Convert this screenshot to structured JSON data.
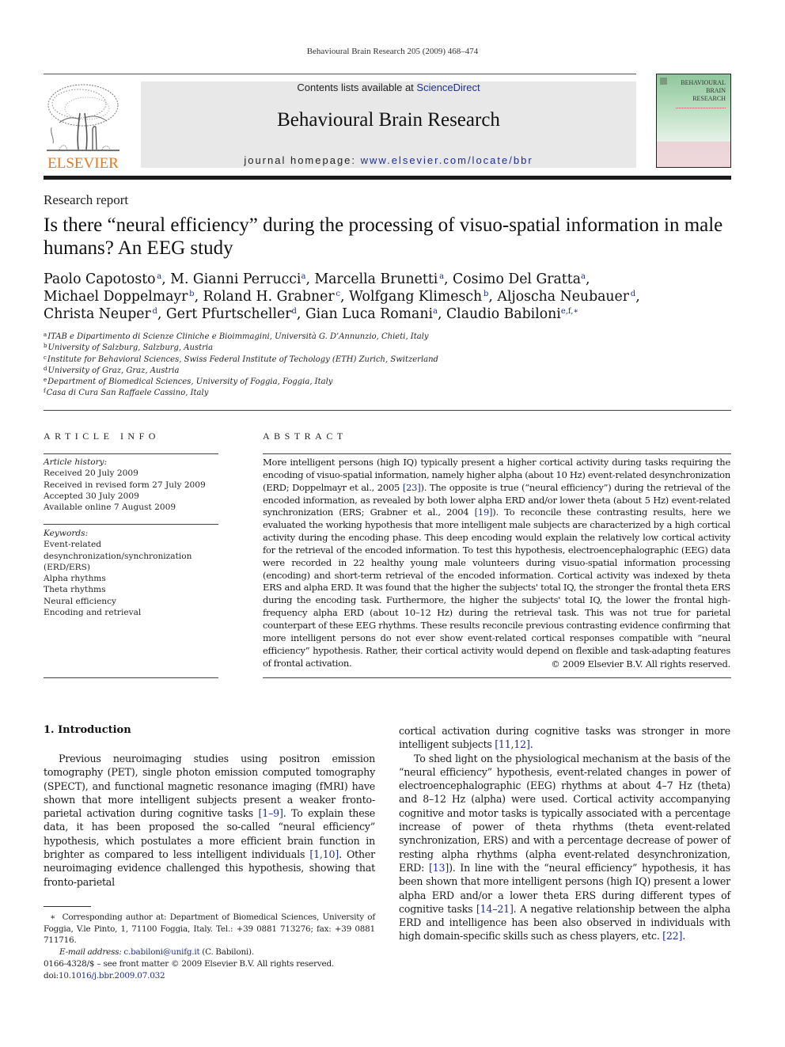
{
  "running_head": "Behavioural Brain Research 205 (2009) 468–474",
  "publisher": {
    "logo_icon": "elsevier-tree-icon",
    "name": "ELSEVIER",
    "brand_color": "#e87722"
  },
  "banner": {
    "contents_prefix": "Contents lists available at ",
    "contents_link": "ScienceDirect",
    "journal_title": "Behavioural Brain Research",
    "homepage_prefix": "journal homepage: ",
    "homepage_link": "www.elsevier.com/locate/bbr",
    "link_color": "#1f2f8f"
  },
  "cover": {
    "title_lines": [
      "BEHAVIOURAL",
      "BRAIN",
      "RESEARCH"
    ]
  },
  "article": {
    "type": "Research report",
    "title": "Is there “neural efficiency” during the processing of visuo-spatial information in male humans? An EEG study",
    "authors": [
      {
        "name": "Paolo Capotosto",
        "sup": "a"
      },
      {
        "name": "M. Gianni Perrucci",
        "sup": "a"
      },
      {
        "name": "Marcella Brunetti",
        "sup": "a"
      },
      {
        "name": "Cosimo Del Gratta",
        "sup": "a"
      },
      {
        "name": "Michael Doppelmayr",
        "sup": "b"
      },
      {
        "name": "Roland H. Grabner",
        "sup": "c"
      },
      {
        "name": "Wolfgang Klimesch",
        "sup": "b"
      },
      {
        "name": "Aljoscha Neubauer",
        "sup": "d"
      },
      {
        "name": "Christa Neuper",
        "sup": "d"
      },
      {
        "name": "Gert Pfurtscheller",
        "sup": "d"
      },
      {
        "name": "Gian Luca Romani",
        "sup": "a"
      },
      {
        "name": "Claudio Babiloni",
        "sup": "e,f,∗"
      }
    ],
    "affiliations": [
      {
        "key": "a",
        "text": "ITAB e Dipartimento di Scienze Cliniche e Bioimmagini, Università G. D’Annunzio, Chieti, Italy"
      },
      {
        "key": "b",
        "text": "University of Salzburg, Salzburg, Austria"
      },
      {
        "key": "c",
        "text": "Institute for Behavioral Sciences, Swiss Federal Institute of Techology (ETH) Zurich, Switzerland"
      },
      {
        "key": "d",
        "text": "University of Graz, Graz, Austria"
      },
      {
        "key": "e",
        "text": "Department of Biomedical Sciences, University of Foggia, Foggia, Italy"
      },
      {
        "key": "f",
        "text": "Casa di Cura San Raffaele Cassino, Italy"
      }
    ]
  },
  "article_info": {
    "heading": "ARTICLE INFO",
    "history_label": "Article history:",
    "history": [
      "Received 20 July 2009",
      "Received in revised form 27 July 2009",
      "Accepted 30 July 2009",
      "Available online 7 August 2009"
    ],
    "keywords_label": "Keywords:",
    "keywords": [
      "Event-related",
      "desynchronization/synchronization",
      "(ERD/ERS)",
      "Alpha rhythms",
      "Theta rhythms",
      "Neural efficiency",
      "Encoding and retrieval"
    ]
  },
  "abstract": {
    "heading": "ABSTRACT",
    "seg1": "More intelligent persons (high IQ) typically present a higher cortical activity during tasks requiring the encoding of visuo-spatial information, namely higher alpha (about 10 Hz) event-related desynchronization (ERD; Doppelmayr et al., 2005 ",
    "ref1": "[23]",
    "seg2": "). The opposite is true (“neural efficiency”) during the retrieval of the encoded information, as revealed by both lower alpha ERD and/or lower theta (about 5 Hz) event-related synchronization (ERS; Grabner et al., 2004 ",
    "ref2": "[19]",
    "seg3": "). To reconcile these contrasting results, here we evaluated the working hypothesis that more intelligent male subjects are characterized by a high cortical activity during the encoding phase. This deep encoding would explain the relatively low cortical activity for the retrieval of the encoded information. To test this hypothesis, electroencephalographic (EEG) data were recorded in 22 healthy young male volunteers during visuo-spatial information processing (encoding) and short-term retrieval of the encoded information. Cortical activity was indexed by theta ERS and alpha ERD. It was found that the higher the subjects' total IQ, the stronger the frontal theta ERS during the encoding task. Furthermore, the higher the subjects' total IQ, the lower the frontal high-frequency alpha ERD (about 10–12 Hz) during the retrieval task. This was not true for parietal counterpart of these EEG rhythms. These results reconcile previous contrasting evidence confirming that more intelligent persons do not ever show event-related cortical responses compatible with “neural efficiency” hypothesis. Rather, their cortical activity would depend on flexible and task-adapting features of frontal activation.",
    "copyright": "© 2009 Elsevier B.V. All rights reserved."
  },
  "introduction": {
    "heading": "1.  Introduction",
    "p1": {
      "seg1": "Previous neuroimaging studies using positron emission tomography (PET), single photon emission computed tomography (SPECT), and functional magnetic resonance imaging (fMRI) have shown that more intelligent subjects present a weaker fronto-parietal activation during cognitive tasks ",
      "ref1": "[1–9]",
      "seg2": ". To explain these data, it has been proposed the so-called “neural efficiency” hypothesis, which postulates a more efficient brain function in brighter as compared to less intelligent individuals ",
      "ref2": "[1,10]",
      "seg3": ". Other neuroimaging evidence challenged this hypothesis, showing that fronto-parietal cortical activation during cognitive tasks was stronger in more intelligent subjects ",
      "ref3": "[11,12]",
      "seg4": "."
    },
    "p2": {
      "seg1": "To shed light on the physiological mechanism at the basis of the “neural efficiency” hypothesis, event-related changes in power of electroencephalographic (EEG) rhythms at about 4–7 Hz (theta) and 8–12 Hz (alpha) were used. Cortical activity accompanying cognitive and motor tasks is typically associated with a percentage increase of power of theta rhythms (theta event-related synchronization, ERS) and with a percentage decrease of power of resting alpha rhythms (alpha event-related desynchronization, ERD: ",
      "ref1": "[13]",
      "seg2": "). In line with the “neural efficiency” hypothesis, it has been shown that more intelligent persons (high IQ) present a lower alpha ERD and/or a lower theta ERS during different types of cognitive tasks ",
      "ref2": "[14–21]",
      "seg3": ". A negative relationship between the alpha ERD and intelligence has been also observed in individuals with high domain-specific skills such as chess players, etc. ",
      "ref3": "[22]",
      "seg4": "."
    }
  },
  "footnote": {
    "marker": "∗",
    "text": "Corresponding author at: Department of Biomedical Sciences, University of Foggia, V.le Pinto, 1, 71100 Foggia, Italy. Tel.: +39 0881 713276; fax: +39 0881 711716.",
    "email_label": "E-mail address:",
    "email": "c.babiloni@unifg.it",
    "email_suffix": " (C. Babiloni)."
  },
  "front_matter": {
    "issn_line": "0166-4328/$ – see front matter © 2009 Elsevier B.V. All rights reserved.",
    "doi_prefix": "doi:",
    "doi": "10.1016/j.bbr.2009.07.032"
  }
}
